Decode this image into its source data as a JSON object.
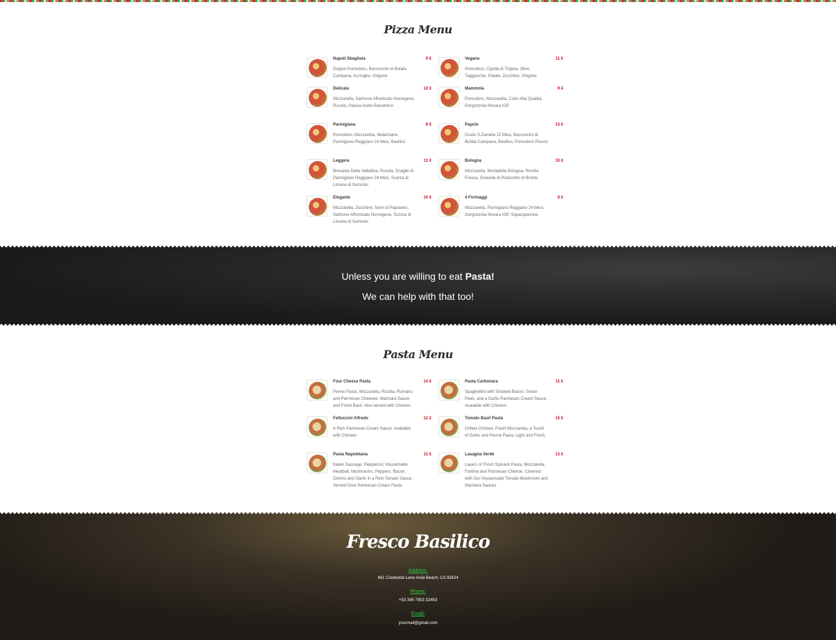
{
  "pizza_menu": {
    "title": "Pizza Menu",
    "items": [
      {
        "name": "Napoli Sbagliata",
        "price": "9 €",
        "desc": "Doppio Pomodoro, Bocconcini di Bufala Campana, Acciughe, Origano"
      },
      {
        "name": "Vegana",
        "price": "11 €",
        "desc": "Pomodoro, Cipolla di Tropea, Olive Taggiasche, Patate, Zucchine, Origano"
      },
      {
        "name": "Delicata",
        "price": "12 €",
        "desc": "Mozzarella, Salmone Affumicato Norvegese, Rucola, Glassa Aceto Balsamico"
      },
      {
        "name": "Mammola",
        "price": "9 €",
        "desc": "Pomodoro, Mozzarella, Cotto Alta Qualità, Gorgonzola Novara IGP"
      },
      {
        "name": "Parmigiana",
        "price": "8 €",
        "desc": "Pomodoro, Mozzarella, Melanzane, Parmigiano Reggiano 24 Mesi, Basilico"
      },
      {
        "name": "Papcio",
        "price": "13 €",
        "desc": "Crudo S.Daniele 22 Mesi, Bocconcini di Bufala Campana, Basilico, Pomodoro Fresco"
      },
      {
        "name": "Leggera",
        "price": "11 €",
        "desc": "Bresaola Della Valtellina, Rucola, Scaglie di Parmigiano Reggiano 24 Mesi, Scorza di Limone di Sorrento"
      },
      {
        "name": "Bologna",
        "price": "10 €",
        "desc": "Mozzarella, Mortadella Bologna, Ricotta Fresca, Granella di Pistacchio di Bronte"
      },
      {
        "name": "Elegante",
        "price": "10 €",
        "desc": "Mozzarella, Zucchine, Semi di Papavero, Salmone Affumicato Norvegese, Scorza di Limone di Sorrento"
      },
      {
        "name": "4 Formaggi",
        "price": "8 €",
        "desc": "Mozzarella, Parmigiano Reggiano 24 Mesi, Gorgonzola Novara IGP, Squacquerone"
      }
    ]
  },
  "banner": {
    "line1_prefix": "Unless you are willing to eat ",
    "line1_bold": "Pasta!",
    "line2": "We can help with that too!"
  },
  "pasta_menu": {
    "title": "Pasta Menu",
    "items": [
      {
        "name": "Four Cheese Pasta",
        "price": "14 €",
        "desc": "Penne Pasta, Mozzarella, Ricotta, Romano and Parmesan Cheeses. Marinara Sauce and Fresh Basil. Also served with Chicken"
      },
      {
        "name": "Pasta Carbonara",
        "price": "11 €",
        "desc": "Spaghettini with Smoked Bacon, Green Peas, and a Garlic-Parmesan Cream Sauce. Available with Chicken"
      },
      {
        "name": "Fettuccini Alfredo",
        "price": "12 €",
        "desc": "A Rich Parmesan Cream Sauce. Available with Chicken"
      },
      {
        "name": "Tomato Basil Pasta",
        "price": "15 €",
        "desc": "Grilled Chicken, Fresh Mozzarella, a Touch of Garlic and Penne Pasta. Light and Fresh."
      },
      {
        "name": "Pasta Napoletana",
        "price": "11 €",
        "desc": "Italian Sausage, Pepperoni, Housemade Meatball, Mushrooms, Peppers, Bacon, Onions and Garlic in a Rich Tomato Sauce. Served Over Parmesan Cream Pasta"
      },
      {
        "name": "Lasagna Verde",
        "price": "13 €",
        "desc": "Layers of Fresh Spinach Pasta, Mozzarella, Fontina and Parmesan Cheese. Covered with Our Housemade Tomato-Mushroom and Marinara Sauces"
      }
    ]
  },
  "footer": {
    "logo": "Fresco Basilico",
    "address_label": "Address:",
    "address": "481 Creekside Lane Avila Beach, CA 93424",
    "phone_label": "Phone:",
    "phone": "+53 345 7953 32453",
    "email_label": "Email:",
    "email": "yourmail@gmail.com",
    "social_icons": [
      "pinterest-icon",
      "facebook-icon",
      "twitter-icon",
      "dribbble-icon",
      "linkedin-icon",
      "vimeo-icon"
    ]
  },
  "colors": {
    "price": "#c6152c",
    "footer_label": "#2ecc40",
    "banner_bg": "#1b1b1b"
  }
}
